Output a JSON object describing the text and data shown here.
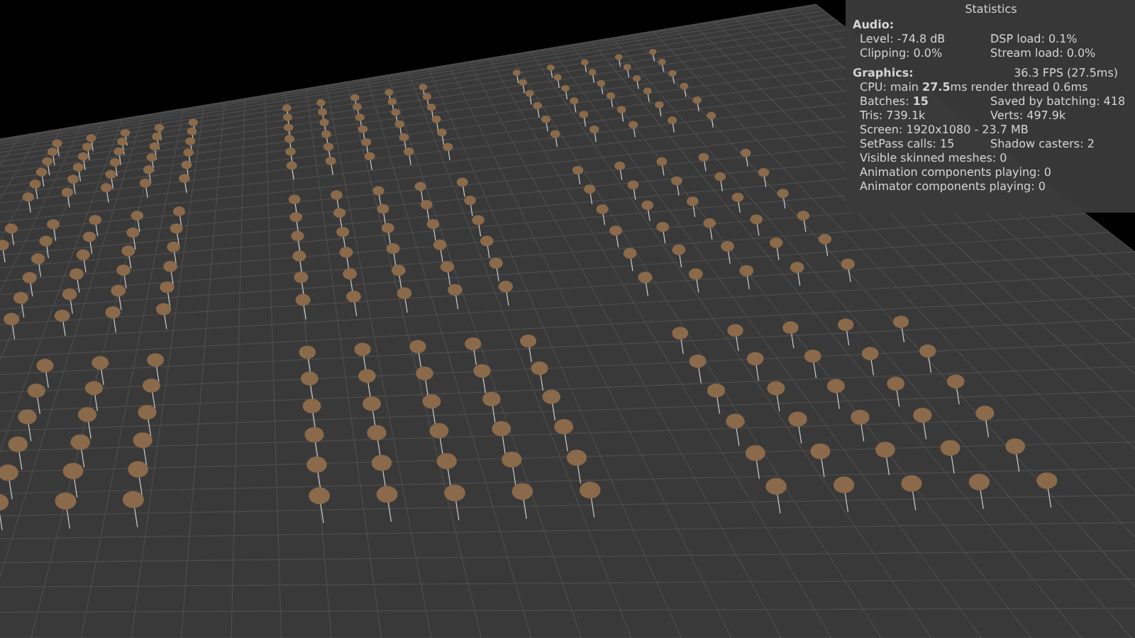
{
  "stats_panel": {
    "title": "Statistics",
    "audio": {
      "heading": "Audio:",
      "rows": [
        [
          "Level: -74.8 dB",
          "DSP load: 0.1%"
        ],
        [
          "Clipping: 0.0%",
          "Stream load: 0.0%"
        ]
      ]
    },
    "graphics": {
      "heading": "Graphics:",
      "fps": "36.3 FPS (27.5ms)",
      "rows": [
        [
          "CPU: main **27.5**ms  render thread 0.6ms"
        ],
        [
          "Batches: **15**",
          "Saved by batching: 418"
        ],
        [
          "Tris: 739.1k",
          "Verts: 497.9k"
        ],
        [
          "Screen: 1920x1080 - 23.7 MB"
        ],
        [
          "SetPass calls: 15",
          "Shadow casters: 2"
        ],
        [
          "Visible skinned meshes: 0"
        ],
        [
          "Animation components playing: 0"
        ],
        [
          "Animator components playing: 0"
        ]
      ]
    }
  }
}
